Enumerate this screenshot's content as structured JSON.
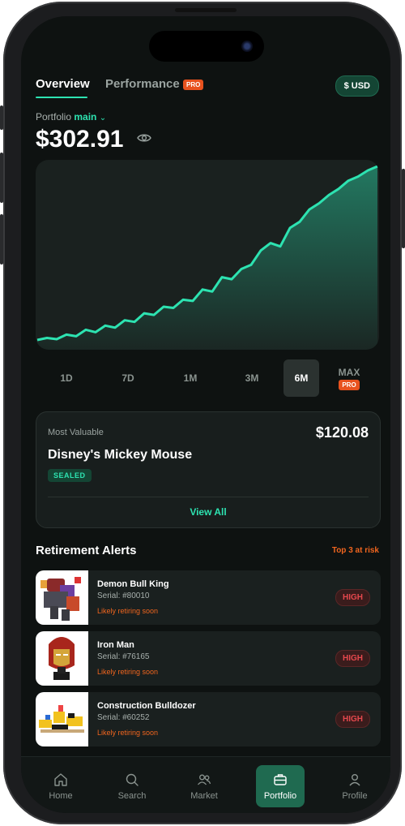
{
  "tabs": {
    "overview": "Overview",
    "performance": "Performance",
    "pro_badge": "PRO",
    "currency": "$ USD"
  },
  "portfolio": {
    "label": "Portfolio",
    "name": "main",
    "chevron": "⌄",
    "value": "$302.91"
  },
  "chart_data": {
    "type": "area",
    "color": "#2de3b1",
    "values": [
      12,
      17,
      14,
      25,
      21,
      37,
      31,
      47,
      42,
      60,
      56,
      77,
      73,
      93,
      90,
      110,
      107,
      135,
      130,
      165,
      160,
      185,
      195,
      230,
      248,
      240,
      285,
      300,
      330,
      345,
      365,
      380,
      400,
      410,
      425,
      435
    ]
  },
  "ranges": {
    "items": [
      "1D",
      "7D",
      "1M",
      "3M",
      "6M"
    ],
    "max": "MAX",
    "max_badge": "PRO",
    "active": "6M"
  },
  "most_valuable": {
    "label": "Most Valuable",
    "price": "$120.08",
    "name": "Disney's Mickey Mouse",
    "badge": "SEALED",
    "view_all": "View All"
  },
  "retirement": {
    "title": "Retirement Alerts",
    "link": "Top 3 at risk",
    "items": [
      {
        "name": "Demon Bull King",
        "serial": "Serial: #80010",
        "status": "Likely retiring soon",
        "risk": "HIGH"
      },
      {
        "name": "Iron Man",
        "serial": "Serial: #76165",
        "status": "Likely retiring soon",
        "risk": "HIGH"
      },
      {
        "name": "Construction Bulldozer",
        "serial": "Serial: #60252",
        "status": "Likely retiring soon",
        "risk": "HIGH"
      }
    ]
  },
  "nav": {
    "items": [
      "Home",
      "Search",
      "Market",
      "Portfolio",
      "Profile"
    ],
    "active": "Portfolio"
  },
  "icons": {
    "eye": "eye-icon",
    "home": "home-icon",
    "search": "search-icon",
    "market": "users-icon",
    "portfolio": "briefcase-icon",
    "profile": "user-icon"
  }
}
